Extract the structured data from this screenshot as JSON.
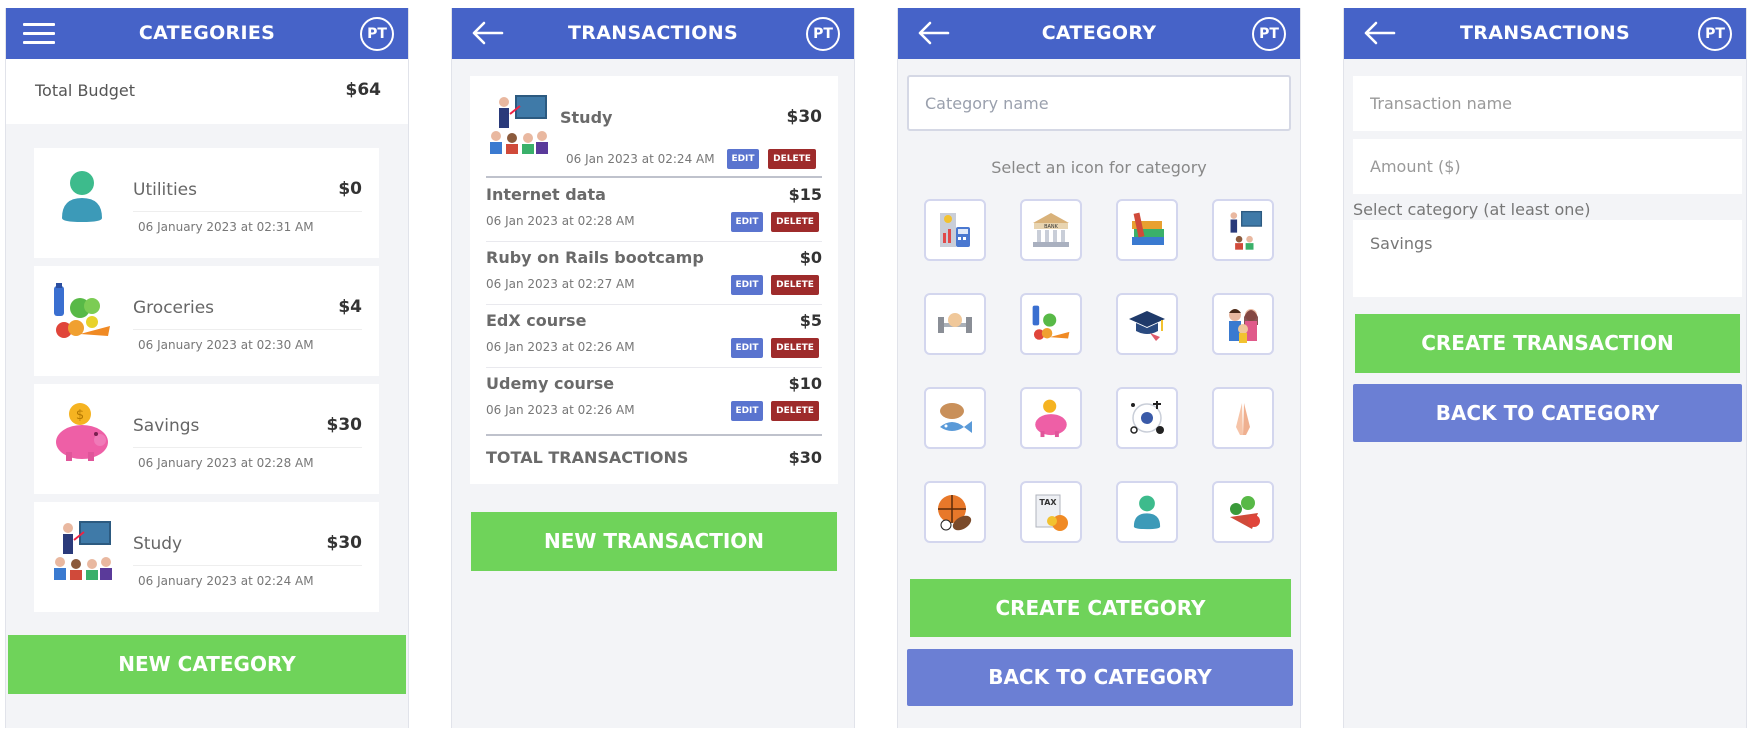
{
  "colors": {
    "header": "#4663c8",
    "green": "#6fd35a",
    "blue_button": "#6b7fd4",
    "delete": "#9e2b2b",
    "edit": "#5a74cf"
  },
  "avatar_initials": "PT",
  "categories_screen": {
    "title": "CATEGORIES",
    "total_budget_label": "Total Budget",
    "total_budget_value": "$64",
    "categories": [
      {
        "name": "Utilities",
        "amount": "$0",
        "date": "06 January 2023 at 02:31 AM",
        "icon": "person-icon"
      },
      {
        "name": "Groceries",
        "amount": "$4",
        "date": "06 January 2023 at 02:30 AM",
        "icon": "groceries-icon"
      },
      {
        "name": "Savings",
        "amount": "$30",
        "date": "06 January 2023 at 02:28 AM",
        "icon": "piggy-bank-icon"
      },
      {
        "name": "Study",
        "amount": "$30",
        "date": "06 January 2023 at 02:24 AM",
        "icon": "teacher-icon"
      }
    ],
    "new_button": "NEW CATEGORY"
  },
  "transactions_screen": {
    "title": "TRANSACTIONS",
    "category_name": "Study",
    "category_amount": "$30",
    "category_date": "06 Jan 2023 at 02:24 AM",
    "edit_label": "EDIT",
    "delete_label": "DELETE",
    "transactions": [
      {
        "name": "Internet data",
        "amount": "$15",
        "date": "06 Jan 2023 at 02:28 AM"
      },
      {
        "name": "Ruby on Rails bootcamp",
        "amount": "$0",
        "date": "06 Jan 2023 at 02:27 AM"
      },
      {
        "name": "EdX course",
        "amount": "$5",
        "date": "06 Jan 2023 at 02:26 AM"
      },
      {
        "name": "Udemy course",
        "amount": "$10",
        "date": "06 Jan 2023 at 02:26 AM"
      }
    ],
    "total_label": "TOTAL TRANSACTIONS",
    "total_value": "$30",
    "new_button": "NEW TRANSACTION"
  },
  "new_category_screen": {
    "title": "CATEGORY",
    "name_placeholder": "Category name",
    "icon_hint": "Select an icon for category",
    "icons": [
      "utilities-icon",
      "bank-icon",
      "books-icon",
      "teacher-icon",
      "gym-icon",
      "groceries-icon",
      "graduation-icon",
      "family-icon",
      "food-icon",
      "piggy-bank-icon",
      "religion-icon",
      "prayer-icon",
      "sports-icon",
      "tax-icon",
      "person-icon",
      "vegetables-icon"
    ],
    "bank_label": "BANK",
    "tax_label": "TAX",
    "create_button": "CREATE CATEGORY",
    "back_button": "BACK TO CATEGORY"
  },
  "new_transaction_screen": {
    "title": "TRANSACTIONS",
    "name_placeholder": "Transaction name",
    "amount_placeholder": "Amount ($)",
    "category_hint": "Select category (at least one)",
    "category_option": "Savings",
    "create_button": "CREATE TRANSACTION",
    "back_button": "BACK TO CATEGORY"
  }
}
